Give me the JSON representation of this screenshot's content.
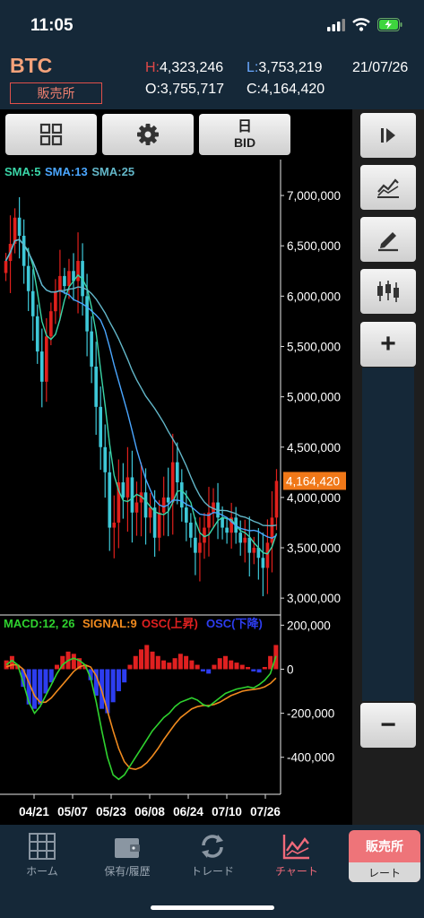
{
  "status": {
    "time": "11:05"
  },
  "header": {
    "symbol": "BTC",
    "market": "販売所",
    "high_key": "H:",
    "high": "4,323,246",
    "low_key": "L:",
    "low": "3,753,219",
    "date": "21/07/26",
    "open_key": "O:",
    "open": "3,755,717",
    "close_key": "C:",
    "close": "4,164,420"
  },
  "toolbar": {
    "day_label": "日",
    "bid_label": "BID"
  },
  "colors": {
    "up": "#e0201c",
    "down": "#3ec8d8",
    "sma5": "#3ad6a8",
    "sma13": "#4aa6ff",
    "sma25": "#63b7c9",
    "macd": "#2fd22f",
    "signal": "#f08a1e",
    "osc_up": "#e02020",
    "osc_down": "#2d3df0",
    "price_tag": "#f07818"
  },
  "chart_data": [
    {
      "type": "candlestick",
      "legend": [
        "SMA:5",
        "SMA:13",
        "SMA:25"
      ],
      "x_ticks": [
        "04/21",
        "05/07",
        "05/23",
        "06/08",
        "06/24",
        "07/10",
        "07/26"
      ],
      "y_ticks": [
        "7,000,000",
        "6,500,000",
        "6,000,000",
        "5,500,000",
        "5,000,000",
        "4,500,000",
        "4,000,000",
        "3,500,000",
        "3,000,000"
      ],
      "ylim": [
        2850000,
        7250000
      ],
      "last_price": 4164420,
      "last_price_label": "4,164,420",
      "close": [
        6350000,
        6520000,
        6780000,
        6600000,
        6300000,
        6050000,
        5800000,
        5450000,
        5150000,
        5600000,
        5850000,
        6050000,
        6200000,
        6100000,
        6250000,
        6150000,
        6350000,
        6000000,
        5650000,
        5300000,
        4900000,
        4500000,
        4250000,
        3700000,
        3750000,
        4150000,
        4000000,
        4200000,
        3850000,
        3950000,
        4050000,
        3800000,
        3900000,
        3600000,
        3850000,
        4000000,
        3950000,
        4350000,
        4150000,
        3900000,
        3750000,
        3600000,
        3450000,
        3550000,
        3700000,
        3850000,
        3950000,
        3800000,
        3700000,
        3650000,
        3800000,
        3650000,
        3550000,
        3600000,
        3450000,
        3500000,
        3400000,
        3300000,
        3550000,
        3800000,
        4164420
      ]
    },
    {
      "type": "macd",
      "legend": [
        "MACD:12, 26",
        "SIGNAL:9",
        "OSC(上昇)",
        "OSC(下降)"
      ],
      "y_ticks": [
        "200,000",
        "0",
        "-200,000",
        "-400,000"
      ],
      "ylim": [
        -560000,
        230000
      ],
      "macd": [
        20000,
        40000,
        20000,
        -60000,
        -150000,
        -200000,
        -170000,
        -120000,
        -70000,
        -20000,
        20000,
        40000,
        50000,
        40000,
        20000,
        -40000,
        -150000,
        -280000,
        -400000,
        -480000,
        -500000,
        -480000,
        -440000,
        -400000,
        -360000,
        -320000,
        -280000,
        -250000,
        -220000,
        -200000,
        -170000,
        -150000,
        -140000,
        -130000,
        -140000,
        -160000,
        -170000,
        -150000,
        -130000,
        -110000,
        -100000,
        -90000,
        -85000,
        -80000,
        -85000,
        -70000,
        -50000,
        -20000,
        60000
      ],
      "signal": [
        10000,
        20000,
        20000,
        0,
        -60000,
        -120000,
        -150000,
        -150000,
        -130000,
        -100000,
        -70000,
        -40000,
        -10000,
        10000,
        20000,
        10000,
        -30000,
        -100000,
        -190000,
        -280000,
        -360000,
        -420000,
        -450000,
        -455000,
        -445000,
        -425000,
        -395000,
        -360000,
        -320000,
        -285000,
        -250000,
        -220000,
        -200000,
        -180000,
        -170000,
        -165000,
        -165000,
        -160000,
        -150000,
        -135000,
        -120000,
        -110000,
        -100000,
        -95000,
        -92000,
        -88000,
        -80000,
        -65000,
        -40000
      ],
      "osc": [
        40000,
        60000,
        20000,
        -80000,
        -160000,
        -180000,
        -160000,
        -110000,
        -60000,
        20000,
        60000,
        80000,
        70000,
        50000,
        20000,
        -50000,
        -120000,
        -180000,
        -200000,
        -150000,
        -100000,
        -60000,
        20000,
        60000,
        90000,
        110000,
        80000,
        60000,
        40000,
        30000,
        50000,
        70000,
        60000,
        40000,
        20000,
        -10000,
        -20000,
        20000,
        50000,
        60000,
        40000,
        30000,
        20000,
        10000,
        -10000,
        -15000,
        10000,
        60000,
        110000
      ]
    }
  ],
  "right_panel": {
    "zoom_in": "+",
    "zoom_out": "−"
  },
  "tabs": [
    {
      "label": "ホーム",
      "icon": "grid-icon"
    },
    {
      "label": "保有/履歴",
      "icon": "wallet-icon"
    },
    {
      "label": "トレード",
      "icon": "refresh-icon"
    },
    {
      "label": "チャート",
      "icon": "chart-icon"
    }
  ],
  "tab_special": {
    "top": "販売所",
    "bottom": "レート"
  }
}
